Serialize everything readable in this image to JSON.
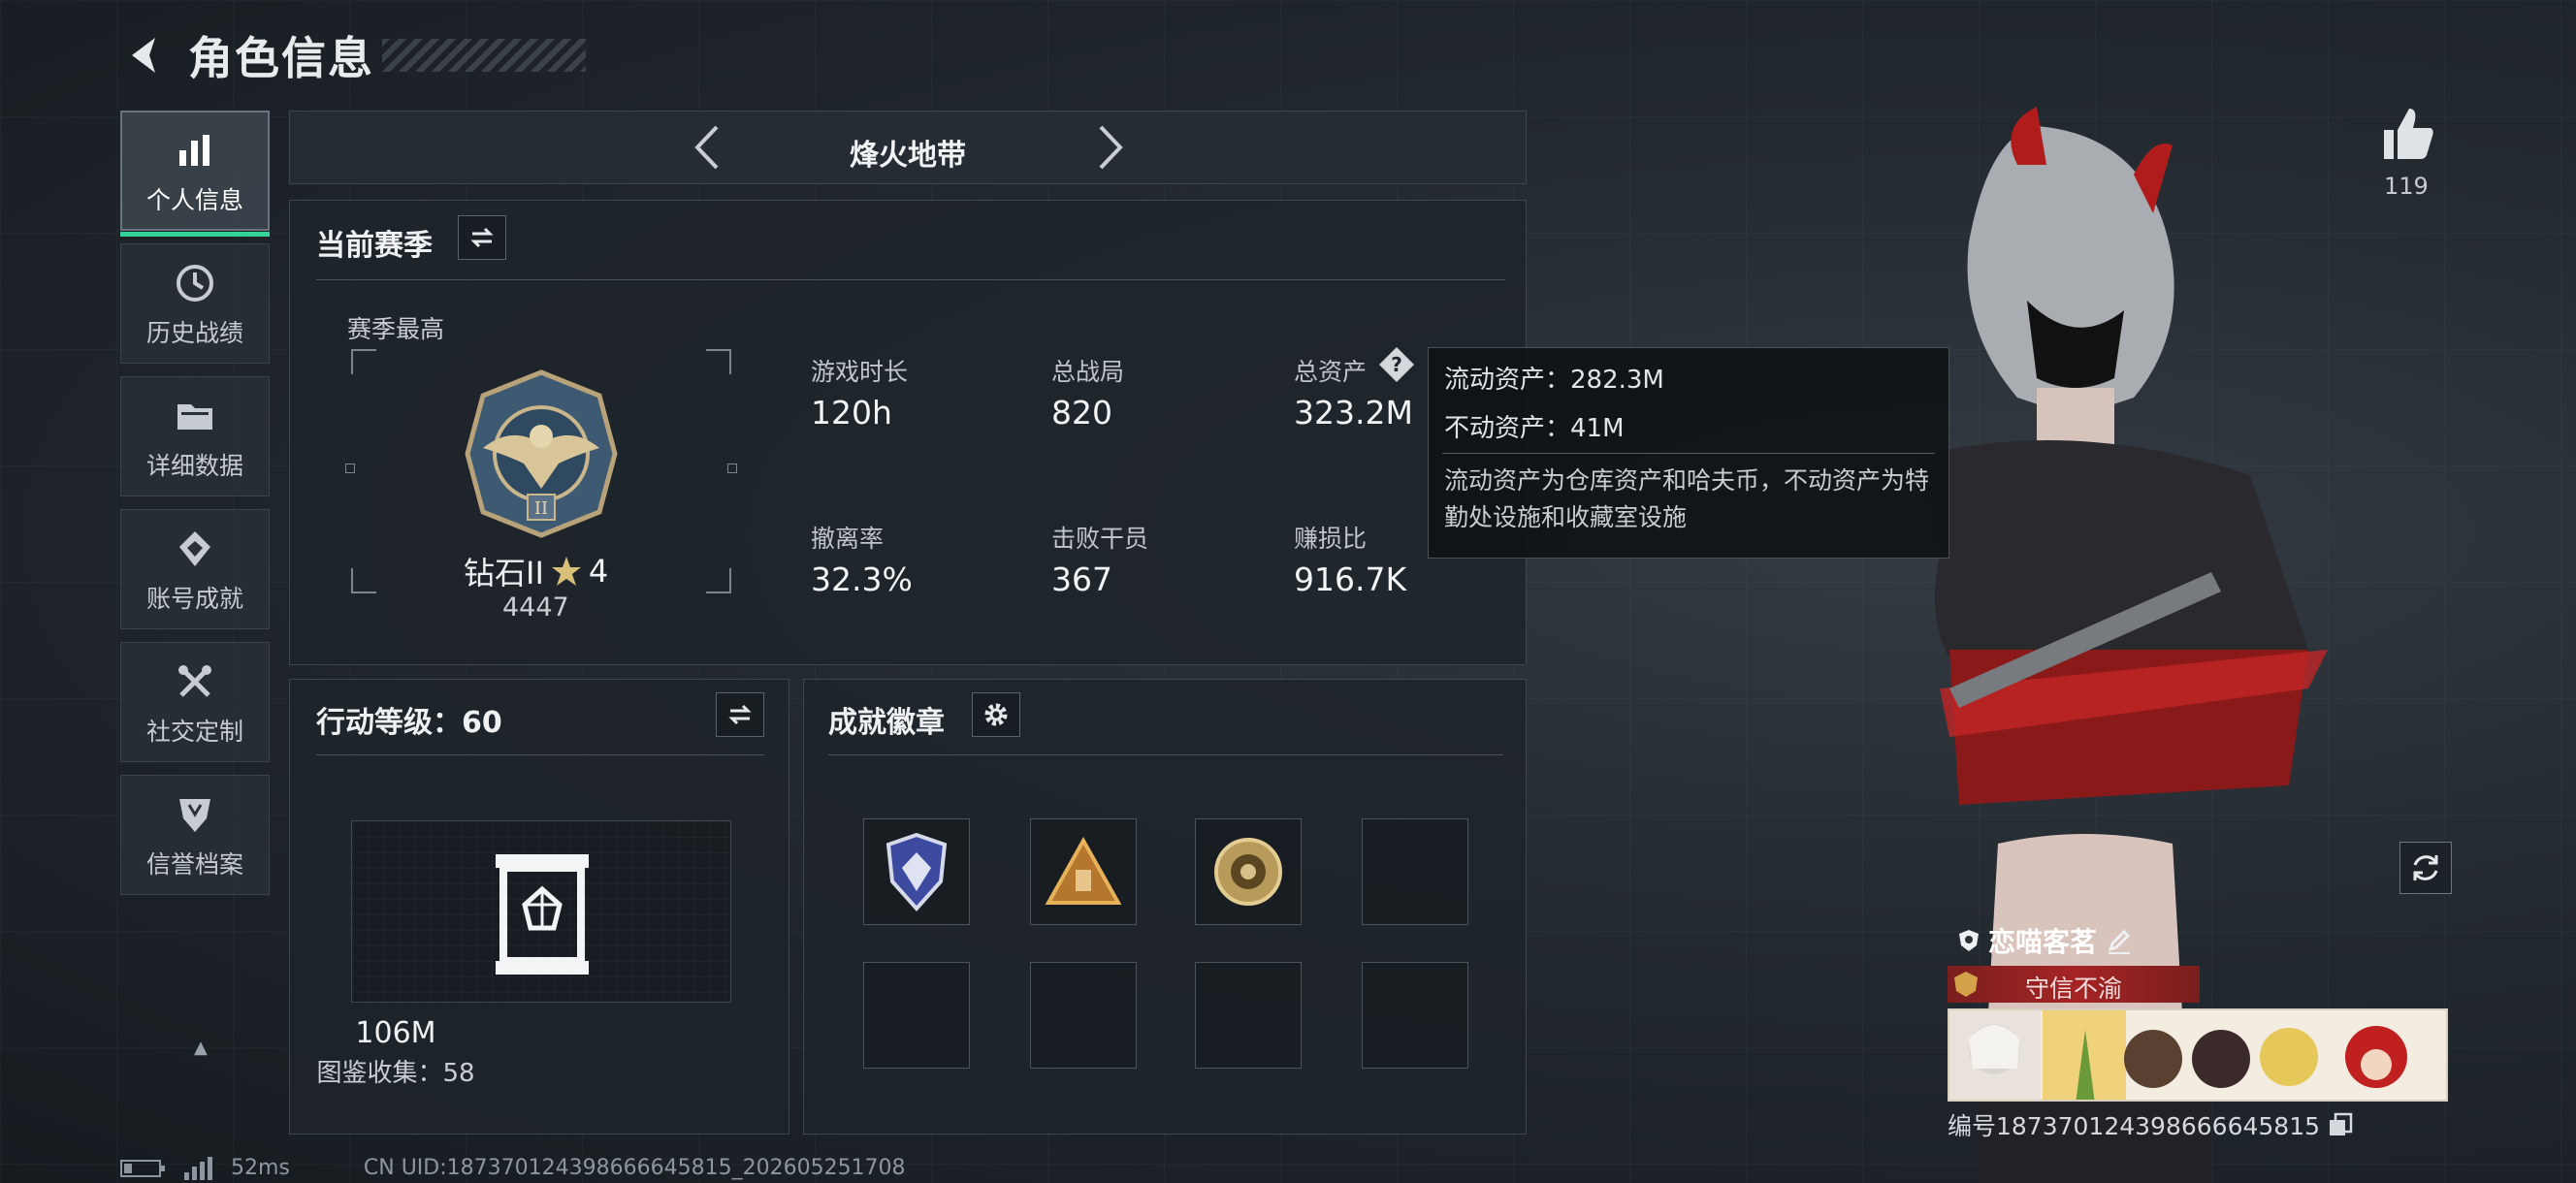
{
  "header": {
    "title": "角色信息"
  },
  "sidebar": {
    "items": [
      {
        "label": "个人信息",
        "icon": "bar-chart-icon",
        "active": true
      },
      {
        "label": "历史战绩",
        "icon": "history-icon",
        "active": false
      },
      {
        "label": "详细数据",
        "icon": "folder-icon",
        "active": false
      },
      {
        "label": "账号成就",
        "icon": "achievement-icon",
        "active": false
      },
      {
        "label": "社交定制",
        "icon": "tools-icon",
        "active": false
      },
      {
        "label": "信誉档案",
        "icon": "shield-icon",
        "active": false
      }
    ]
  },
  "mode": {
    "title": "烽火地带"
  },
  "season": {
    "title": "当前赛季",
    "best_label": "赛季最高",
    "rank_name": "钻石II",
    "rank_stars": "4",
    "rank_score": "4447",
    "stats": [
      {
        "label": "游戏时长",
        "value": "120h"
      },
      {
        "label": "总战局",
        "value": "820"
      },
      {
        "label": "总资产",
        "value": "323.2M"
      },
      {
        "label": "撤离率",
        "value": "32.3%"
      },
      {
        "label": "击败干员",
        "value": "367"
      },
      {
        "label": "赚损比",
        "value": "916.7K"
      }
    ]
  },
  "tooltip": {
    "liquid": "流动资产：282.3M",
    "fixed": "不动资产：41M",
    "desc": "流动资产为仓库资产和哈夫币，不动资产为特勤处设施和收藏室设施"
  },
  "action_level": {
    "title": "行动等级：60",
    "collection_value": "106M",
    "collection_count": "图鉴收集：58"
  },
  "badges": {
    "title": "成就徽章"
  },
  "likes": {
    "count": "119"
  },
  "player": {
    "name": "恋喵客茗",
    "title": "守信不渝",
    "uid": "编号1873701243986666458​15"
  },
  "footer": {
    "ping": "52ms",
    "uid": "CN UID:1873701243986666458​15_202605251708"
  },
  "colors": {
    "accent": "#34d39a",
    "title_red": "#a52424",
    "background": "#1b2127"
  }
}
